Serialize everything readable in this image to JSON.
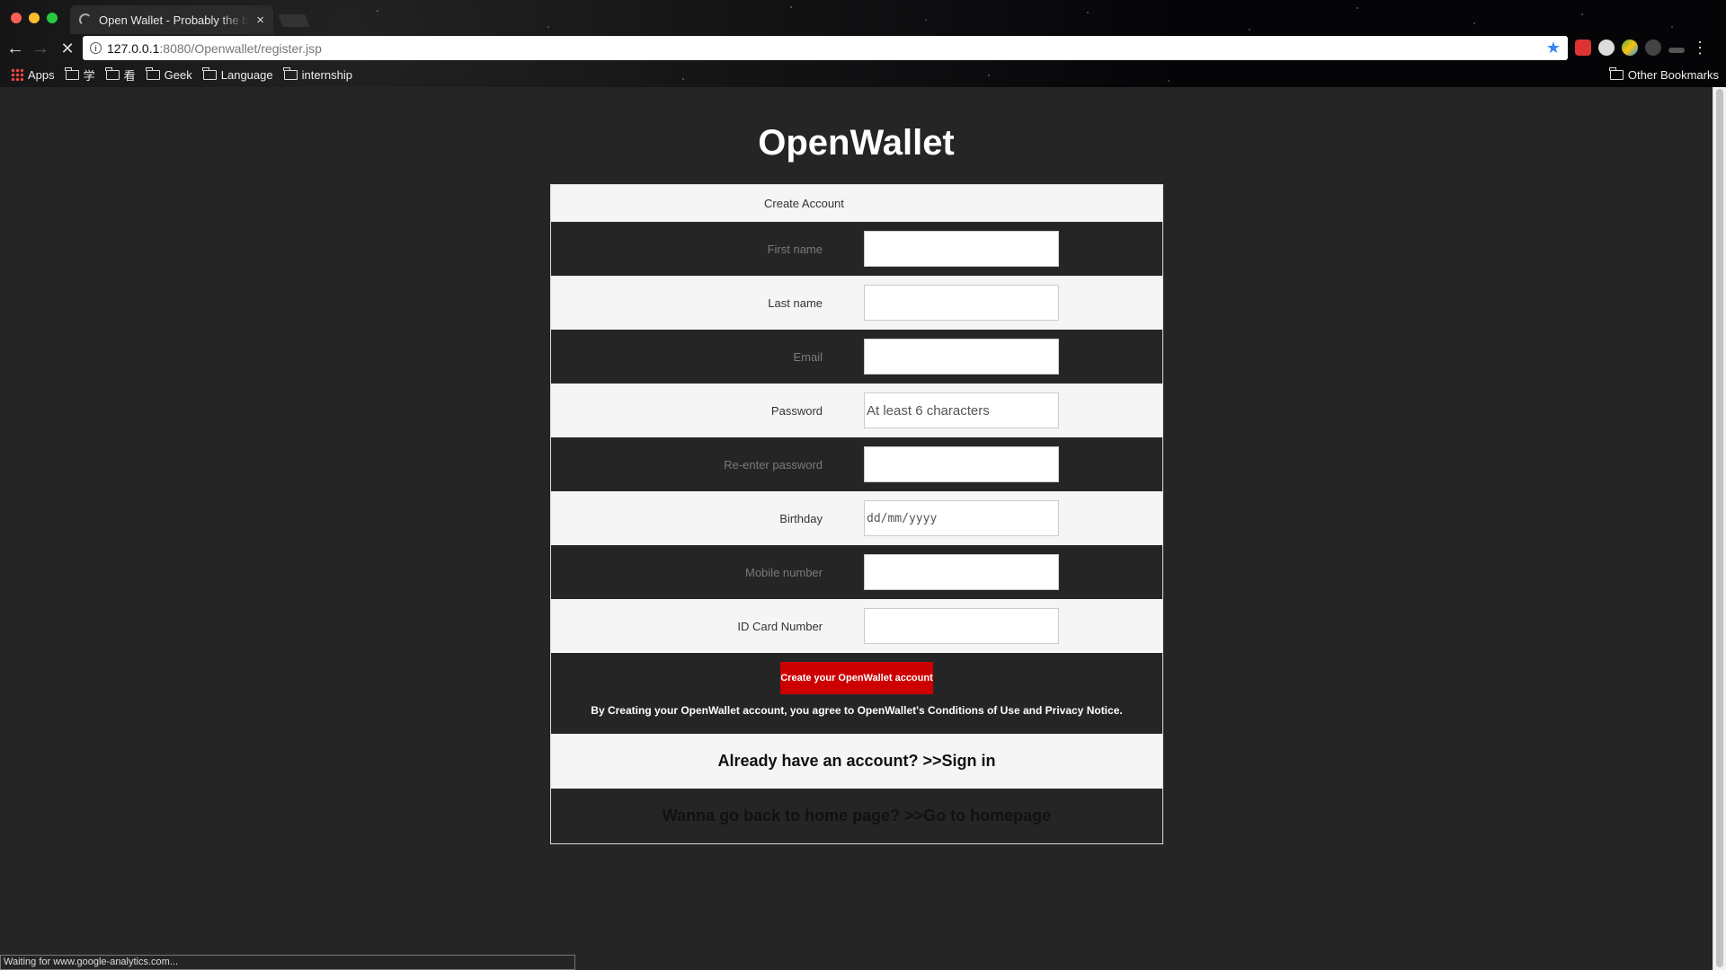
{
  "browser": {
    "tab_title": "Open Wallet - Probably the best",
    "tab_close": "×",
    "url_host": "127.0.0.1",
    "url_path": ":8080/Openwallet/register.jsp",
    "bookmarks": [
      "Apps",
      "学",
      "看",
      "Geek",
      "Language",
      "internship"
    ],
    "other_bookmarks": "Other Bookmarks",
    "status": "Waiting for www.google-analytics.com..."
  },
  "page": {
    "brand": "OpenWallet",
    "form_title": "Create Account",
    "fields": [
      {
        "label": "First name",
        "placeholder": ""
      },
      {
        "label": "Last name",
        "placeholder": ""
      },
      {
        "label": "Email",
        "placeholder": ""
      },
      {
        "label": "Password",
        "placeholder": "At least 6 characters"
      },
      {
        "label": "Re-enter password",
        "placeholder": ""
      },
      {
        "label": "Birthday",
        "placeholder": "dd/mm/yyyy"
      },
      {
        "label": "Mobile number",
        "placeholder": ""
      },
      {
        "label": "ID Card Number",
        "placeholder": ""
      }
    ],
    "submit_label": "Create your OpenWallet account",
    "terms": "By Creating your OpenWallet account, you agree to OpenWallet's Conditions of Use and Privacy Notice.",
    "signin": "Already have an account? >>Sign in",
    "homepage": "Wanna go back to home page? >>Go to homepage"
  },
  "colors": {
    "page_bg": "#252525",
    "light_row": "#f5f5f5",
    "accent": "#cc0000",
    "star": "#3b82f6"
  }
}
